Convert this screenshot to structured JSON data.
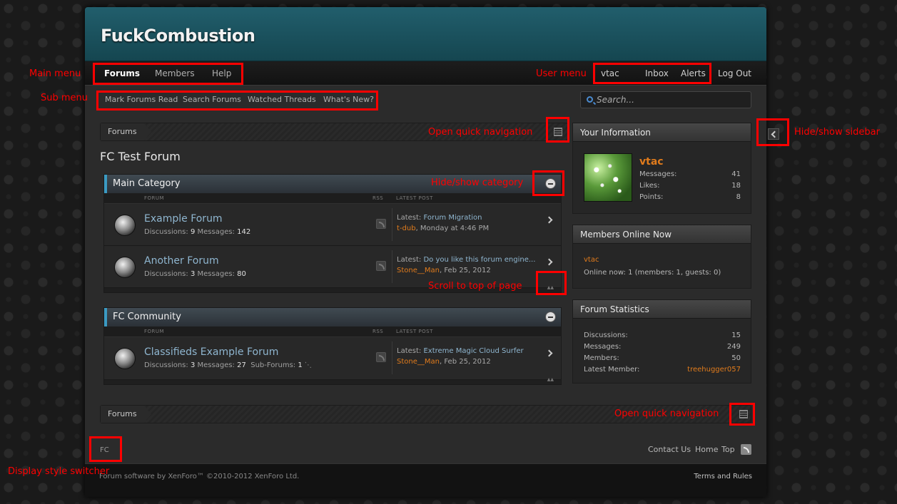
{
  "site": {
    "logo": "FuckCombustion"
  },
  "nav": {
    "tabs": [
      "Forums",
      "Members",
      "Help"
    ],
    "user": {
      "name": "vtac",
      "inbox": "Inbox",
      "alerts": "Alerts",
      "logout": "Log Out"
    }
  },
  "subnav": {
    "items": [
      "Mark Forums Read",
      "Search Forums",
      "Watched Threads",
      "What's New?"
    ]
  },
  "search": {
    "placeholder": "Search..."
  },
  "breadcrumb": {
    "label": "Forums"
  },
  "page": {
    "title": "FC Test Forum"
  },
  "columns": {
    "forum": "FORUM",
    "rss": "RSS",
    "latest": "LATEST POST"
  },
  "categories": [
    {
      "title": "Main Category",
      "forums": [
        {
          "name": "Example Forum",
          "discussions_label": "Discussions:",
          "discussions": "9",
          "messages_label": "Messages:",
          "messages": "142",
          "latest_label": "Latest:",
          "latest_title": "Forum Migration",
          "latest_user": "t-dub",
          "latest_date": ", Monday at 4:46 PM"
        },
        {
          "name": "Another Forum",
          "discussions_label": "Discussions:",
          "discussions": "3",
          "messages_label": "Messages:",
          "messages": "80",
          "latest_label": "Latest:",
          "latest_title": "Do you like this forum engine...",
          "latest_user": "Stone__Man",
          "latest_date": ", Feb 25, 2012"
        }
      ]
    },
    {
      "title": "FC Community",
      "forums": [
        {
          "name": "Classifieds Example Forum",
          "discussions_label": "Discussions:",
          "discussions": "3",
          "messages_label": "Messages:",
          "messages": "27",
          "subforums_label": "Sub-Forums:",
          "subforums": "1",
          "latest_label": "Latest:",
          "latest_title": "Extreme Magic Cloud Surfer",
          "latest_user": "Stone__Man",
          "latest_date": ", Feb 25, 2012"
        }
      ]
    }
  ],
  "sidebar": {
    "your_info": {
      "title": "Your Information",
      "username": "vtac",
      "messages_label": "Messages:",
      "messages": "41",
      "likes_label": "Likes:",
      "likes": "18",
      "points_label": "Points:",
      "points": "8"
    },
    "online": {
      "title": "Members Online Now",
      "user": "vtac",
      "summary": "Online now: 1 (members: 1, guests: 0)"
    },
    "stats": {
      "title": "Forum Statistics",
      "discussions_label": "Discussions:",
      "discussions": "15",
      "messages_label": "Messages:",
      "messages": "249",
      "members_label": "Members:",
      "members": "50",
      "latest_label": "Latest Member:",
      "latest": "treehugger057"
    }
  },
  "footer": {
    "style_switcher": "FC",
    "contact": "Contact Us",
    "home": "Home",
    "top": "Top",
    "copyright": "Forum software by XenForo™ ©2010-2012 XenForo Ltd.",
    "terms": "Terms and Rules"
  },
  "annotations": {
    "main_menu": "Main menu",
    "sub_menu": "Sub menu",
    "user_menu": "User menu",
    "quick_nav": "Open quick navigation",
    "hide_sidebar": "Hide/show sidebar",
    "hide_category": "Hide/show category",
    "scroll_top": "Scroll to top of page",
    "quick_nav_bottom": "Open quick navigation",
    "style_switcher": "Display style switcher"
  },
  "colors": {
    "accent": "#3b9ac2",
    "link_orange": "#e07b1c",
    "annotation": "#ff0000"
  }
}
